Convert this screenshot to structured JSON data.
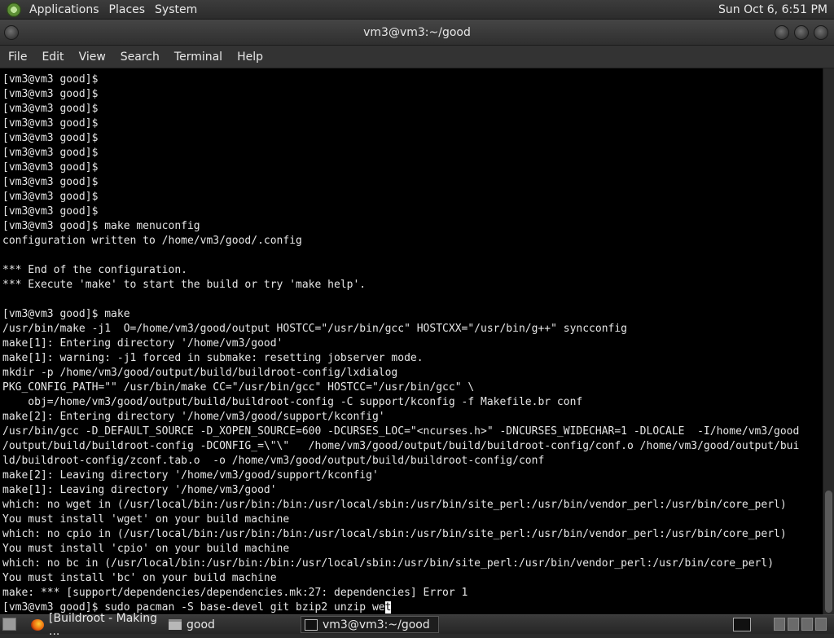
{
  "top_panel": {
    "menus": [
      "Applications",
      "Places",
      "System"
    ],
    "clock": "Sun Oct  6,  6:51 PM"
  },
  "window": {
    "title": "vm3@vm3:~/good"
  },
  "menubar": {
    "items": [
      "File",
      "Edit",
      "View",
      "Search",
      "Terminal",
      "Help"
    ]
  },
  "terminal": {
    "lines": [
      "[vm3@vm3 good]$",
      "[vm3@vm3 good]$",
      "[vm3@vm3 good]$",
      "[vm3@vm3 good]$",
      "[vm3@vm3 good]$",
      "[vm3@vm3 good]$",
      "[vm3@vm3 good]$",
      "[vm3@vm3 good]$",
      "[vm3@vm3 good]$",
      "[vm3@vm3 good]$",
      "[vm3@vm3 good]$ make menuconfig",
      "configuration written to /home/vm3/good/.config",
      "",
      "*** End of the configuration.",
      "*** Execute 'make' to start the build or try 'make help'.",
      "",
      "[vm3@vm3 good]$ make",
      "/usr/bin/make -j1  O=/home/vm3/good/output HOSTCC=\"/usr/bin/gcc\" HOSTCXX=\"/usr/bin/g++\" syncconfig",
      "make[1]: Entering directory '/home/vm3/good'",
      "make[1]: warning: -j1 forced in submake: resetting jobserver mode.",
      "mkdir -p /home/vm3/good/output/build/buildroot-config/lxdialog",
      "PKG_CONFIG_PATH=\"\" /usr/bin/make CC=\"/usr/bin/gcc\" HOSTCC=\"/usr/bin/gcc\" \\",
      "    obj=/home/vm3/good/output/build/buildroot-config -C support/kconfig -f Makefile.br conf",
      "make[2]: Entering directory '/home/vm3/good/support/kconfig'",
      "/usr/bin/gcc -D_DEFAULT_SOURCE -D_XOPEN_SOURCE=600 -DCURSES_LOC=\"<ncurses.h>\" -DNCURSES_WIDECHAR=1 -DLOCALE  -I/home/vm3/good",
      "/output/build/buildroot-config -DCONFIG_=\\\"\\\"   /home/vm3/good/output/build/buildroot-config/conf.o /home/vm3/good/output/bui",
      "ld/buildroot-config/zconf.tab.o  -o /home/vm3/good/output/build/buildroot-config/conf",
      "make[2]: Leaving directory '/home/vm3/good/support/kconfig'",
      "make[1]: Leaving directory '/home/vm3/good'",
      "which: no wget in (/usr/local/bin:/usr/bin:/bin:/usr/local/sbin:/usr/bin/site_perl:/usr/bin/vendor_perl:/usr/bin/core_perl)",
      "You must install 'wget' on your build machine",
      "which: no cpio in (/usr/local/bin:/usr/bin:/bin:/usr/local/sbin:/usr/bin/site_perl:/usr/bin/vendor_perl:/usr/bin/core_perl)",
      "You must install 'cpio' on your build machine",
      "which: no bc in (/usr/local/bin:/usr/bin:/bin:/usr/local/sbin:/usr/bin/site_perl:/usr/bin/vendor_perl:/usr/bin/core_perl)",
      "You must install 'bc' on your build machine",
      "make: *** [support/dependencies/dependencies.mk:27: dependencies] Error 1"
    ],
    "prompt_line": "[vm3@vm3 good]$ sudo pacman -S base-devel git bzip2 unzip we",
    "cursor_char": "t"
  },
  "taskbar": {
    "tasks": [
      {
        "label": "[Buildroot - Making ...",
        "icon": "firefox-icon"
      },
      {
        "label": "good",
        "icon": "folder-icon"
      },
      {
        "label": "vm3@vm3:~/good",
        "icon": "terminal-icon",
        "active": true
      }
    ]
  }
}
